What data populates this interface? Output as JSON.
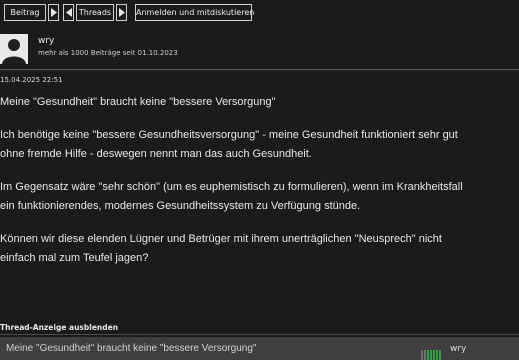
{
  "toolbar": {
    "beitrag_label": "Beitrag",
    "threads_label": "Threads",
    "login_label": "Anmelden und mitdiskutieren"
  },
  "user": {
    "name": "wry",
    "info": "mehr als 1000 Beiträge seit 01.10.2023"
  },
  "post": {
    "timestamp": "15.04.2025 22:51",
    "title": "Meine \"Gesundheit\" braucht keine \"bessere Versorgung\"",
    "paragraphs": [
      [
        "Ich benötige keine \"bessere Gesundheitsversorgung\" - meine Gesundheit funktioniert sehr gut",
        "ohne fremde Hilfe - deswegen nennt man das auch Gesundheit."
      ],
      [
        "Im Gegensatz wäre \"sehr schön\" (um es euphemistisch zu formulieren), wenn im Krankheitsfall",
        "ein funktionierendes, modernes Gesundheitssystem zu Verfügung stünde."
      ],
      [
        "Können wir diese elenden Lügner und Betrüger mit ihrem unerträglichen \"Neusprech\" nicht",
        "einfach mal zum Teufel jagen?"
      ]
    ]
  },
  "thread_toggle_label": "Thread-Anzeige ausblenden",
  "footer": {
    "title": "Meine \"Gesundheit\" braucht keine \"bessere Versorgung\"",
    "user": "wry"
  },
  "icons": {
    "beitrag_arrow": "triangle-right-icon",
    "threads_arrow_left": "triangle-left-icon",
    "threads_arrow_right": "triangle-right-icon",
    "avatar": "default-avatar-icon",
    "rating": "rating-bars-icon"
  },
  "colors": {
    "background": "#1b1b1b",
    "footer": "#3f3f3f",
    "rating_green": "#2ea043"
  }
}
